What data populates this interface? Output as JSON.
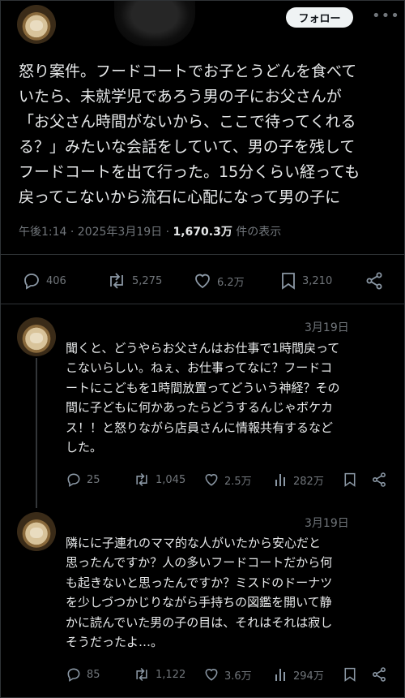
{
  "header": {
    "follow_label": "フォロー",
    "more_label": "•••"
  },
  "post": {
    "text": "怒り案件。フードコートでお子とうどんを食べて\nいたら、未就学児であろう男の子にお父さんが\n「お父さん時間がないから、ここで待ってくれる\nる？」みたいな会話をしていて、男の子を残して\nフードコートを出て行った。15分くらい経っても\n戻ってこないから流石に心配になって男の子に",
    "time_prefix": "午後1:14 · 2025年3月19日 · ",
    "views": "1,670.3万",
    "views_suffix": " 件の表示",
    "actions": {
      "replies": "406",
      "reposts": "5,275",
      "likes": "6.2万",
      "bookmarks": "3,210"
    }
  },
  "replies": [
    {
      "date": "3月19日",
      "text": "聞くと、どうやらお父さんはお仕事で1時間戻って\nこないらしい。ねぇ、お仕事ってなに？フードコ\nートにこどもを1時間放置ってどういう神経？その\n間に子どもに何かあったらどうするんじゃボケカ\nス！！と怒りながら店員さんに情報共有するなど\nした。",
      "actions": {
        "replies": "25",
        "reposts": "1,045",
        "likes": "2.5万",
        "views": "282万"
      }
    },
    {
      "date": "3月19日",
      "text": "隣にに子連れのママ的な人がいたから安心だと\n思ったんですか？人の多いフードコートだから何\nも起きないと思ったんですか？ミスドのドーナツ\nを少しづつかじりながら手持ちの図鑑を開いて静\nかに読んでいた男の子の目は、それはそれは寂し\nそうだったよ…。",
      "actions": {
        "replies": "85",
        "reposts": "1,122",
        "likes": "3.6万",
        "views": "294万"
      }
    }
  ],
  "colors": {
    "background": "#000000",
    "text": "#e7e9ea",
    "muted": "#71767b",
    "border": "#2f3336"
  }
}
